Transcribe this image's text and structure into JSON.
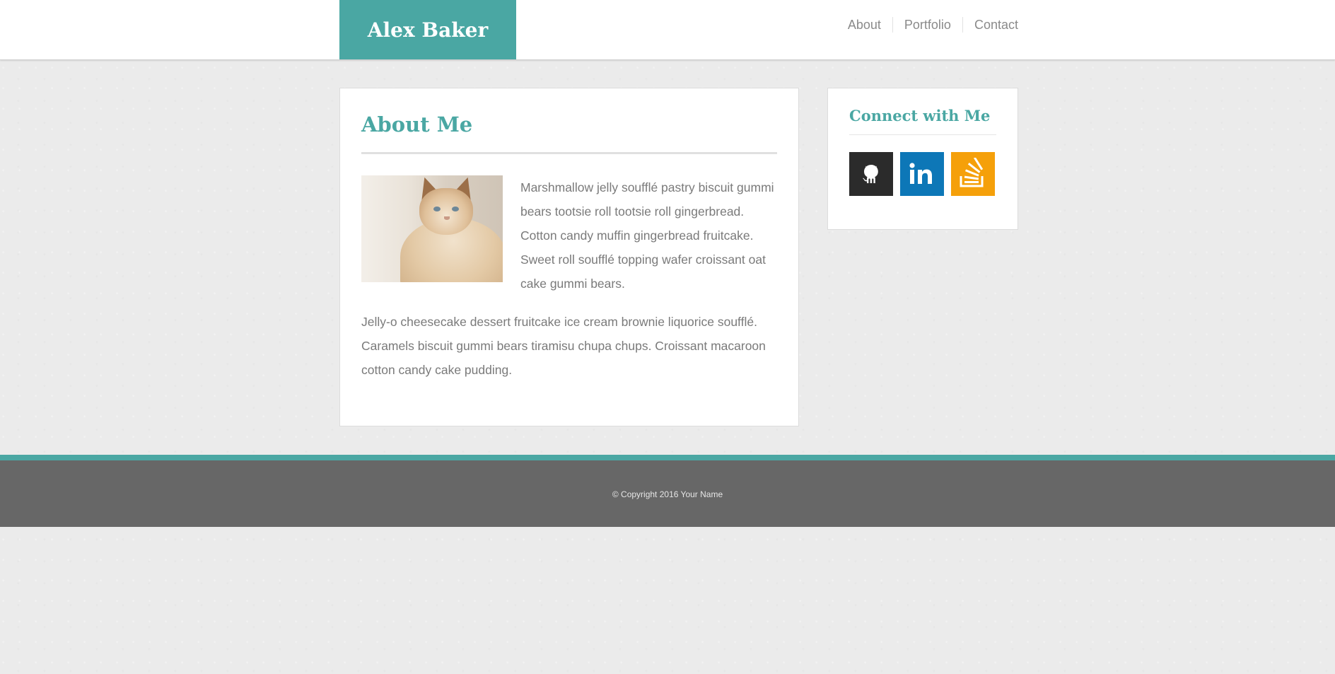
{
  "theme": {
    "accent": "#4aa7a3",
    "footer_bg": "#676767",
    "github_color": "#2b2b2b",
    "linkedin_color": "#0d77b7",
    "stackoverflow_color": "#f5a00a"
  },
  "header": {
    "brand": "Alex Baker",
    "nav": [
      {
        "label": "About"
      },
      {
        "label": "Portfolio"
      },
      {
        "label": "Contact"
      }
    ]
  },
  "main": {
    "title": "About Me",
    "photo_icon": "cat-photo",
    "paragraphs": [
      "Marshmallow jelly soufflé pastry biscuit gummi bears tootsie roll tootsie roll gingerbread. Cotton candy muffin gingerbread fruitcake. Sweet roll soufflé topping wafer croissant oat cake gummi bears.",
      "Jelly-o cheesecake dessert fruitcake ice cream brownie liquorice soufflé. Caramels biscuit gummi bears tiramisu chupa chups. Croissant macaroon cotton candy cake pudding."
    ]
  },
  "sidebar": {
    "title": "Connect with Me",
    "social": [
      {
        "icon": "github-icon"
      },
      {
        "icon": "linkedin-icon"
      },
      {
        "icon": "stackoverflow-icon"
      }
    ]
  },
  "footer": {
    "copyright": "© Copyright 2016 Your Name"
  }
}
